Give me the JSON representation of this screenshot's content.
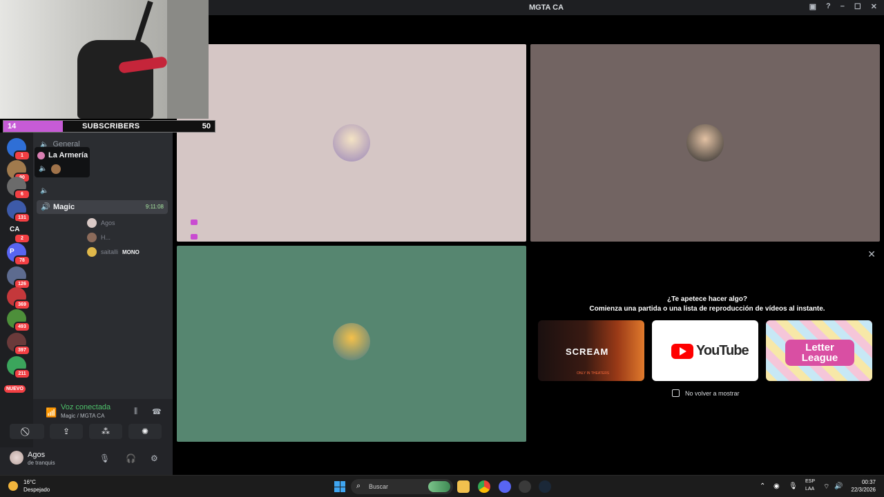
{
  "window": {
    "title": "MGTA CA"
  },
  "overlay": {
    "subscribers": {
      "label": "SUBSCRIBERS",
      "current": "14",
      "goal": "50",
      "progress": 0.28
    }
  },
  "servers": [
    {
      "badge": "1",
      "color": "#2f6fd6"
    },
    {
      "badge": "90",
      "color": "#a07a4d"
    },
    {
      "badge": "6",
      "color": "#6b6b6b"
    },
    {
      "badge": "131",
      "color": "#3d5aa8"
    },
    {
      "badge": "2",
      "color": "#1e1f22",
      "text": "CA"
    },
    {
      "badge": "78",
      "color": "#5865f2",
      "text": "P"
    },
    {
      "badge": "126",
      "color": "#5d6b8f"
    },
    {
      "badge": "369",
      "color": "#c4383b"
    },
    {
      "badge": "493",
      "color": "#4d8f3a"
    },
    {
      "badge": "397",
      "color": "#6a3a3a"
    },
    {
      "badge": "211",
      "color": "#3ba55c"
    }
  ],
  "new_badge": "NUEVO",
  "channels": {
    "general": "General",
    "tooltip_server": "La Armería",
    "magic": {
      "name": "Magic",
      "time": "9:11:08"
    },
    "members": [
      {
        "name": "Agos",
        "tag": ""
      },
      {
        "name": "H...",
        "tag": ""
      },
      {
        "name": "saitalli",
        "tag": "MONO"
      }
    ]
  },
  "voice": {
    "status": "Voz conectada",
    "channel": "Magic / MGTA CA"
  },
  "user": {
    "name": "Agos",
    "status": "de tranquis"
  },
  "activity": {
    "question": "¿Te apetece hacer algo?",
    "subtitle": "Comienza una partida o una lista de reproducción de vídeos al instante.",
    "cards": [
      {
        "name": "SCREAM",
        "tagline": "ONLY IN THEATERS"
      },
      {
        "name": "YouTube"
      },
      {
        "name": "Letter League"
      }
    ],
    "dont_show": "No volver a mostrar"
  },
  "taskbar": {
    "temp": "16°C",
    "condition": "Despejado",
    "search_placeholder": "Buscar",
    "lang": "ESP",
    "lang_region": "LAA",
    "time": "00:37",
    "date": "22/3/2026"
  }
}
